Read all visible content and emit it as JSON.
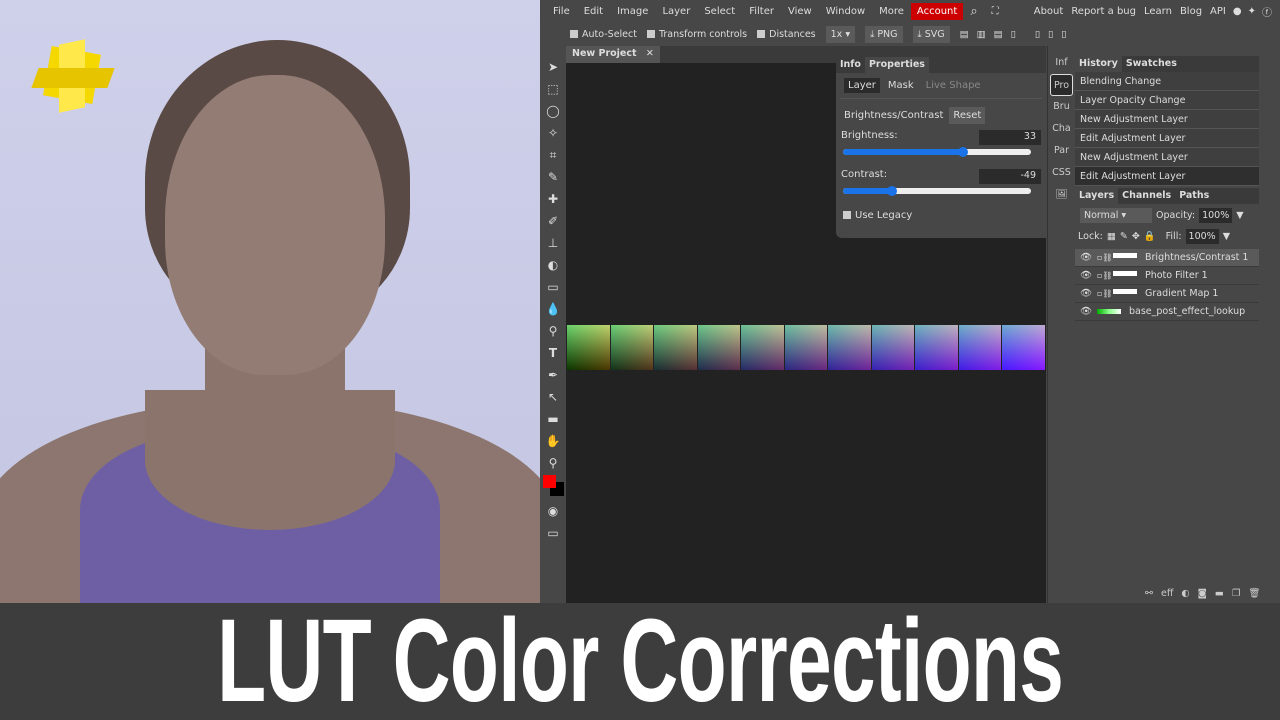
{
  "menu": {
    "items": [
      "File",
      "Edit",
      "Image",
      "Layer",
      "Select",
      "Filter",
      "View",
      "Window",
      "More"
    ],
    "account": "Account",
    "right": [
      "About",
      "Report a bug",
      "Learn",
      "Blog",
      "API"
    ]
  },
  "toolbar": {
    "auto_select": "Auto-Select",
    "transform": "Transform controls",
    "distances": "Distances",
    "zoom": "1x",
    "png": "PNG",
    "svg": "SVG"
  },
  "document_tab": "New Project",
  "properties": {
    "tabs": [
      "Info",
      "Properties"
    ],
    "subtabs": [
      "Layer",
      "Mask",
      "Live Shape"
    ],
    "adjustment": "Brightness/Contrast",
    "reset": "Reset",
    "brightness_label": "Brightness:",
    "brightness": "33",
    "brightness_pct": 0.64,
    "contrast_label": "Contrast:",
    "contrast": "-49",
    "contrast_pct": 0.26,
    "use_legacy": "Use Legacy"
  },
  "side_tabs": [
    "Inf",
    "Pro",
    "Bru",
    "Cha",
    "Par",
    "CSS"
  ],
  "history": {
    "tabs": [
      "History",
      "Swatches"
    ],
    "items": [
      "Blending Change",
      "Layer Opacity Change",
      "New Adjustment Layer",
      "Edit Adjustment Layer",
      "New Adjustment Layer",
      "Edit Adjustment Layer"
    ]
  },
  "layers": {
    "tabs": [
      "Layers",
      "Channels",
      "Paths"
    ],
    "blend": "Normal",
    "opacity_label": "Opacity:",
    "opacity": "100%",
    "lock_label": "Lock:",
    "fill_label": "Fill:",
    "fill": "100%",
    "items": [
      "Brightness/Contrast 1",
      "Photo Filter 1",
      "Gradient Map 1",
      "base_post_effect_lookup"
    ],
    "footer_eff": "eff"
  },
  "banner": {
    "title": "LUT Color Corrections"
  },
  "colors": {
    "foreground": "#ff0000",
    "background": "#000000",
    "accent": "#1a73e8",
    "account": "#cc0000"
  }
}
